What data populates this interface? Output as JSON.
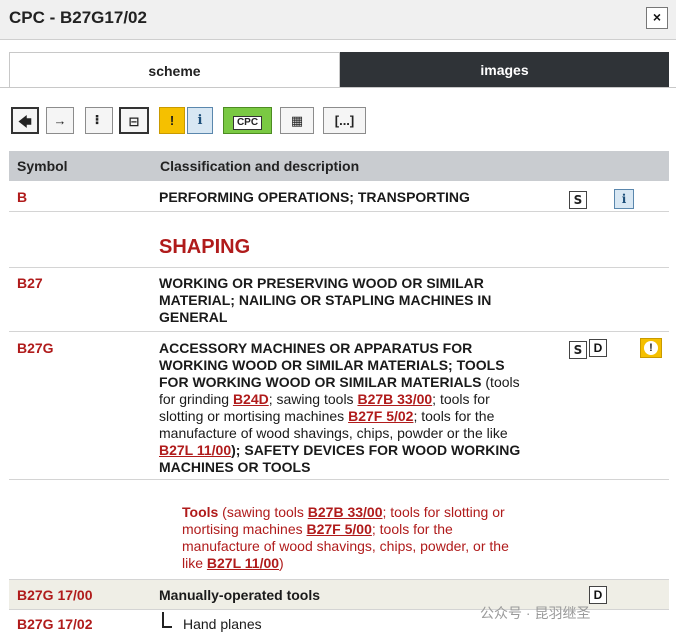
{
  "window": {
    "title": "CPC - B27G17/02",
    "close_label": "×"
  },
  "tabs": [
    {
      "label": "scheme",
      "active": true
    },
    {
      "label": "images",
      "active": false
    }
  ],
  "toolbar": {
    "prev_label": "🡄",
    "next_label": "→",
    "collapse_label": "⠇",
    "expand_label": "⊟",
    "warn_label": "!",
    "info_label": "i",
    "cpc_label": "CPC",
    "table_label": "▦",
    "more_label": "[...]"
  },
  "table": {
    "headers": {
      "symbol": "Symbol",
      "description": "Classification and description"
    }
  },
  "rows": {
    "b": {
      "symbol": "B",
      "text": "PERFORMING OPERATIONS; TRANSPORTING",
      "s_icon": "S",
      "i_icon": "i"
    },
    "shaping": {
      "text": "SHAPING"
    },
    "b27": {
      "symbol": "B27",
      "lines": [
        "WORKING OR PRESERVING WOOD OR SIMILAR",
        "MATERIAL; NAILING OR STAPLING MACHINES IN",
        "GENERAL"
      ]
    },
    "b27g": {
      "symbol": "B27G",
      "l1": "ACCESSORY MACHINES OR APPARATUS FOR",
      "l2": "WORKING WOOD OR SIMILAR MATERIALS; TOOLS",
      "l3a": "FOR WORKING WOOD OR SIMILAR MATERIALS",
      "l3b": " (tools",
      "l4a": "for grinding ",
      "ref1": "B24D",
      "l4b": "; sawing tools ",
      "ref2": "B27B 33/00",
      "l4c": "; tools for",
      "l5a": "slotting or mortising machines ",
      "ref3": "B27F 5/02",
      "l5b": "; tools for the",
      "l6": "manufacture of wood shavings, chips, powder or the like",
      "ref4": "B27L 11/00",
      "l7b": "); ",
      "l7c": "SAFETY DEVICES FOR WOOD WORKING",
      "l8": "MACHINES OR TOOLS",
      "s_icon": "S",
      "d_icon": "D",
      "w_icon": "!"
    },
    "tools_note": {
      "title": "Tools",
      "l1a": " (sawing tools ",
      "ref1": "B27B 33/00",
      "l1b": "; tools for slotting or",
      "l2a": "mortising machines ",
      "ref2": "B27F 5/00",
      "l2b": "; tools for the",
      "l3": "manufacture of wood shavings, chips, powder, or the",
      "l4a": "like ",
      "ref3": "B27L 11/00",
      "l4b": ")"
    },
    "b27g1700": {
      "symbol": "B27G 17/00",
      "text": "Manually-operated tools",
      "d_icon": "D"
    },
    "b27g1702": {
      "symbol": "B27G 17/02",
      "text": "Hand planes"
    }
  },
  "watermark": "公众号 · 昆羽继圣",
  "colors": {
    "accent_red": "#b01b1b",
    "tab_dark": "#2f3337",
    "header_gray": "#c9ccd0",
    "warn_yellow": "#f5c000",
    "cpc_green": "#7ac943"
  }
}
